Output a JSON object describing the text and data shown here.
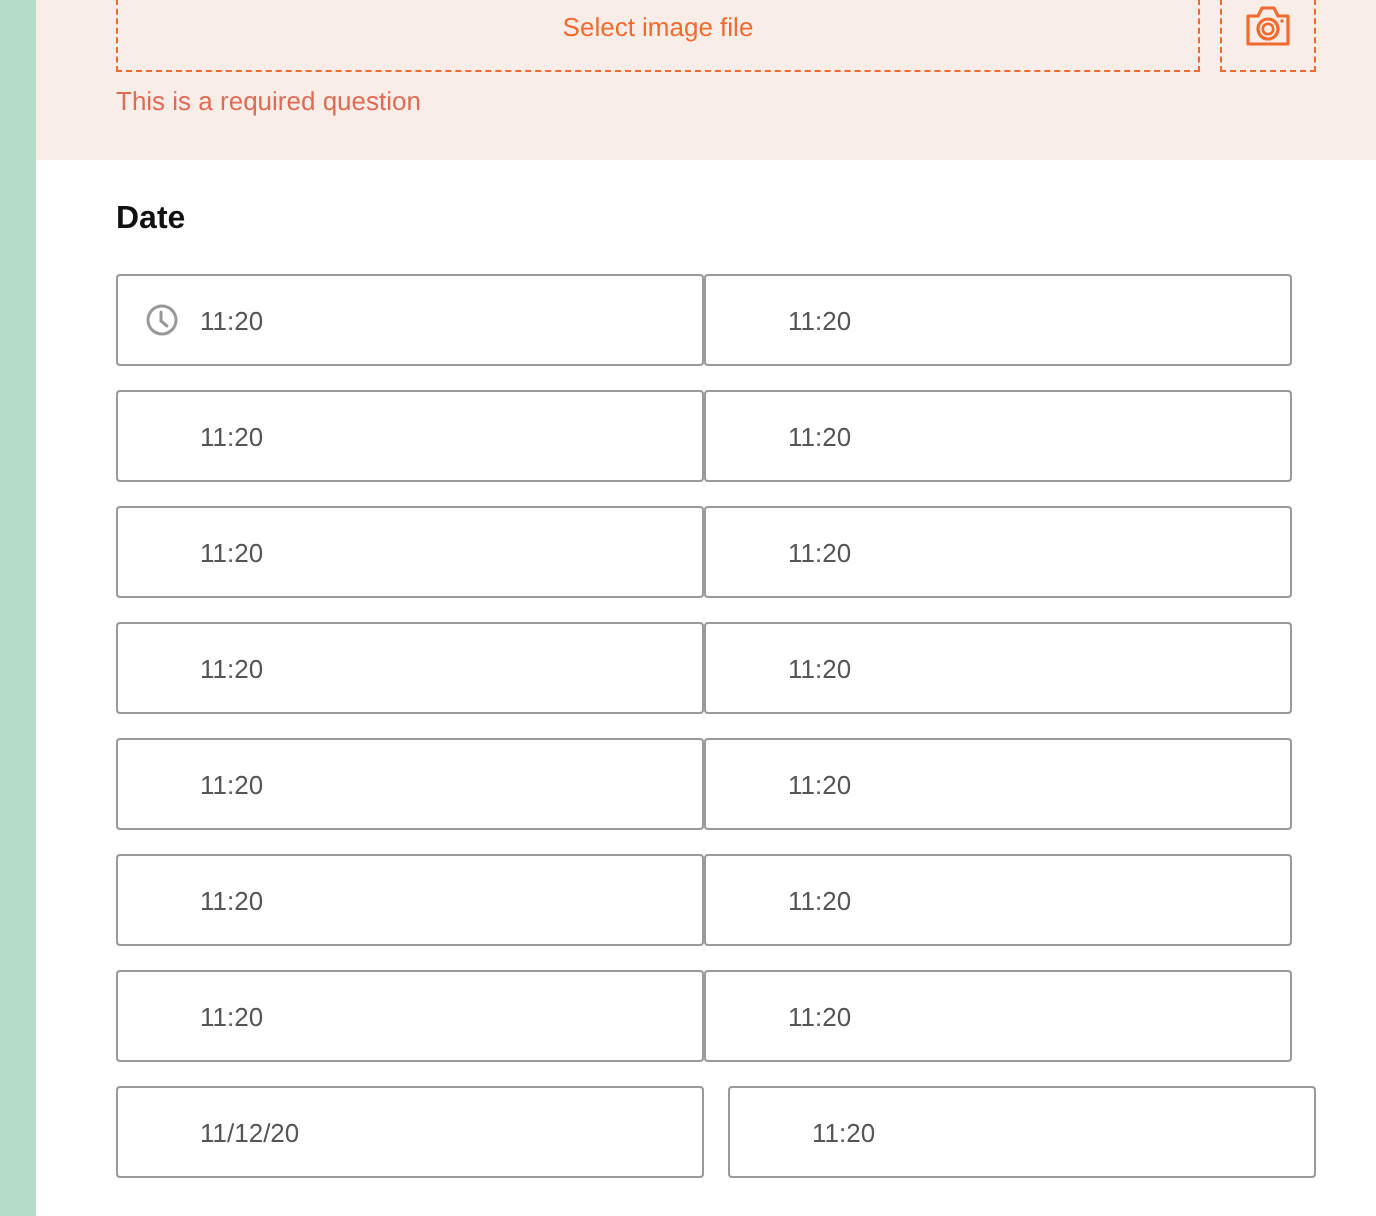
{
  "upload": {
    "label": "Select image file",
    "error": "This is a required question"
  },
  "date": {
    "label": "Date",
    "rows": [
      {
        "kind": "joined",
        "fields": [
          {
            "kind": "clock",
            "value": "11:20"
          },
          {
            "kind": "plain",
            "value": "11:20"
          }
        ]
      },
      {
        "kind": "joined",
        "fields": [
          {
            "kind": "plain",
            "value": "11:20"
          },
          {
            "kind": "plain",
            "value": "11:20"
          }
        ]
      },
      {
        "kind": "joined",
        "fields": [
          {
            "kind": "plain",
            "value": "11:20"
          },
          {
            "kind": "plain",
            "value": "11:20"
          }
        ]
      },
      {
        "kind": "joined",
        "fields": [
          {
            "kind": "plain",
            "value": "11:20"
          },
          {
            "kind": "plain",
            "value": "11:20"
          }
        ]
      },
      {
        "kind": "joined",
        "fields": [
          {
            "kind": "plain",
            "value": "11:20"
          },
          {
            "kind": "plain",
            "value": "11:20"
          }
        ]
      },
      {
        "kind": "joined",
        "fields": [
          {
            "kind": "plain",
            "value": "11:20"
          },
          {
            "kind": "plain",
            "value": "11:20"
          }
        ]
      },
      {
        "kind": "joined",
        "fields": [
          {
            "kind": "plain",
            "value": "11:20"
          },
          {
            "kind": "plain",
            "value": "11:20"
          }
        ]
      },
      {
        "kind": "spaced",
        "fields": [
          {
            "kind": "plain",
            "value": "11/12/20"
          },
          {
            "kind": "plain",
            "value": "11:20"
          }
        ]
      }
    ]
  }
}
